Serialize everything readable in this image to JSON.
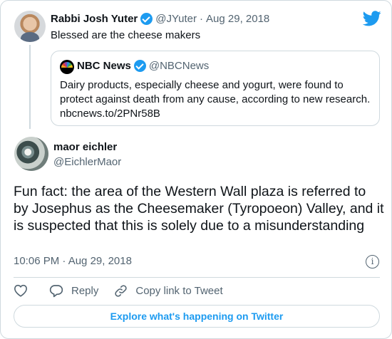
{
  "parent_tweet": {
    "author_name": "Rabbi Josh Yuter",
    "handle": "@JYuter",
    "separator": "·",
    "date": "Aug 29, 2018",
    "text": "Blessed are the cheese makers",
    "quoted_tweet": {
      "author_name": "NBC News",
      "handle": "@NBCNews",
      "text": "Dairy products, especially cheese and yogurt, were found to protect against death from any cause, according to new research. nbcnews.to/2PNr58B"
    }
  },
  "main_tweet": {
    "author_name": "maor eichler",
    "handle": "@EichlerMaor",
    "text": "Fun fact: the area of the Western Wall plaza is referred to by Josephus as the Cheesemaker (Tyropoeon) Valley, and it is suspected that this is solely due to a misunderstanding",
    "timestamp": "10:06 PM · Aug 29, 2018"
  },
  "actions": {
    "reply_label": "Reply",
    "copy_link_label": "Copy link to Tweet"
  },
  "explore_label": "Explore what's happening on Twitter",
  "colors": {
    "brand_blue": "#1d9bf0",
    "secondary_text": "#536471",
    "border": "#cfd9de"
  },
  "icons": [
    "twitter-bird-icon",
    "verified-badge-icon",
    "info-icon",
    "heart-icon",
    "reply-icon",
    "link-icon"
  ]
}
